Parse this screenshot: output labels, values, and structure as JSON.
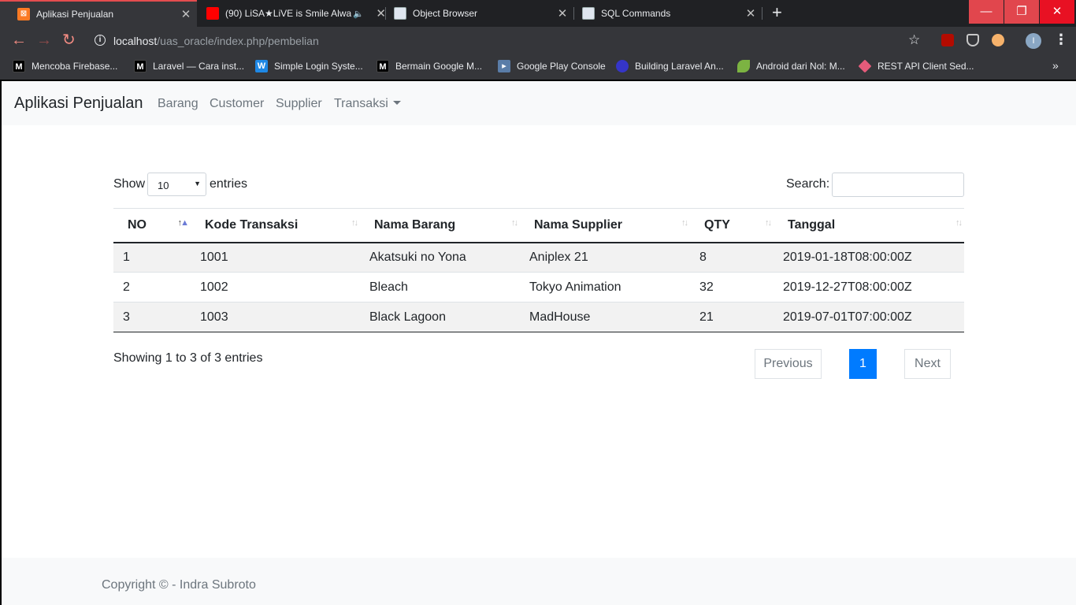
{
  "browser": {
    "tabs": [
      {
        "title": "Aplikasi Penjualan",
        "favicon": "xampp-icon",
        "active": true
      },
      {
        "title": "(90) LiSA★LiVE is Smile Alwa",
        "favicon": "youtube-icon",
        "audio": true
      },
      {
        "title": "Object Browser",
        "favicon": "page-icon"
      },
      {
        "title": "SQL Commands",
        "favicon": "page-icon"
      }
    ],
    "url_host": "localhost",
    "url_path": "/uas_oracle/index.php/pembelian",
    "profile_initial": "I",
    "bookmarks": [
      {
        "label": "Mencoba Firebase...",
        "icon": "medium-icon"
      },
      {
        "label": "Laravel — Cara inst...",
        "icon": "medium-icon"
      },
      {
        "label": "Simple Login Syste...",
        "icon": "w-icon"
      },
      {
        "label": "Bermain Google M...",
        "icon": "medium-icon"
      },
      {
        "label": "Google Play Console",
        "icon": "play-console-icon"
      },
      {
        "label": "Building Laravel An...",
        "icon": "cloud-icon"
      },
      {
        "label": "Android dari Nol: M...",
        "icon": "leaf-icon"
      },
      {
        "label": "REST API Client Sed...",
        "icon": "diamond-icon"
      }
    ]
  },
  "navbar": {
    "brand": "Aplikasi Penjualan",
    "links": [
      "Barang",
      "Customer",
      "Supplier",
      "Transaksi"
    ]
  },
  "controls": {
    "show_label": "Show",
    "entries_label": "entries",
    "page_length": "10",
    "search_label": "Search:"
  },
  "table": {
    "headers": [
      "NO",
      "Kode Transaksi",
      "Nama Barang",
      "Nama Supplier",
      "QTY",
      "Tanggal"
    ],
    "rows": [
      [
        "1",
        "1001",
        "Akatsuki no Yona",
        "Aniplex 21",
        "8",
        "2019-01-18T08:00:00Z"
      ],
      [
        "2",
        "1002",
        "Bleach",
        "Tokyo Animation",
        "32",
        "2019-12-27T08:00:00Z"
      ],
      [
        "3",
        "1003",
        "Black Lagoon",
        "MadHouse",
        "21",
        "2019-07-01T07:00:00Z"
      ]
    ]
  },
  "pagination": {
    "info": "Showing 1 to 3 of 3 entries",
    "previous": "Previous",
    "current": "1",
    "next": "Next"
  },
  "footer": {
    "copyright": "Copyright © - Indra Subroto"
  }
}
